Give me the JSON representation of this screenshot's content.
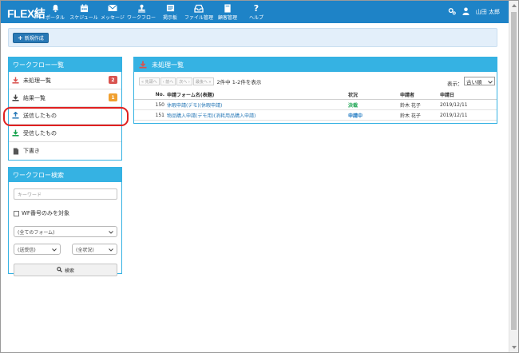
{
  "app": {
    "logo": "FLEX結",
    "nav": [
      {
        "label": "ポータル",
        "icon": "bell-icon"
      },
      {
        "label": "スケジュール",
        "icon": "calendar-icon"
      },
      {
        "label": "メッセージ",
        "icon": "envelope-icon"
      },
      {
        "label": "ワークフロー",
        "icon": "stamp-icon"
      },
      {
        "label": "掲示板",
        "icon": "board-icon"
      },
      {
        "label": "ファイル管理",
        "icon": "inbox-icon"
      },
      {
        "label": "顧客管理",
        "icon": "book-icon"
      },
      {
        "label": "ヘルプ",
        "icon": "question-icon"
      }
    ],
    "user_name": "山田 太郎"
  },
  "toolbar": {
    "new_label": "新規作成"
  },
  "workflow_list": {
    "title": "ワークフロー一覧",
    "items": [
      {
        "label": "未処理一覧",
        "icon": "download-red-icon",
        "badge": "2",
        "badge_color": "#d9534f"
      },
      {
        "label": "結果一覧",
        "icon": "download-dark-icon",
        "badge": "1",
        "badge_color": "#f0a030"
      },
      {
        "label": "送信したもの",
        "icon": "upload-blue-icon",
        "badge": ""
      },
      {
        "label": "受信したもの",
        "icon": "download-green-icon",
        "badge": ""
      },
      {
        "label": "下書き",
        "icon": "document-icon",
        "badge": ""
      }
    ]
  },
  "workflow_search": {
    "title": "ワークフロー検索",
    "keyword_placeholder": "キーワード",
    "wf_number_only_label": "WF番号のみを対象",
    "form_select": "(全てのフォーム)",
    "direction_select": "(送受信)",
    "status_select": "(全状況)",
    "search_button": "検索"
  },
  "main": {
    "title": "未処理一覧",
    "pager": {
      "first": "« 先頭へ",
      "prev": "‹ 前へ",
      "next": "次へ ›",
      "last": "最後へ »",
      "count_text": "2件中 1-2件を表示"
    },
    "display_label": "表示：",
    "display_value": "古い順",
    "columns": [
      "No.",
      "申請フォーム名(表題)",
      "状況",
      "申請者",
      "申請日"
    ],
    "rows": [
      {
        "no": "150",
        "form": "休暇申請(デモ)(休暇申請)",
        "status": "決裁",
        "applicant": "鈴木 花子",
        "date": "2019/12/11"
      },
      {
        "no": "151",
        "form": "物品購入申請(デモ用)(消耗用品購入申請)",
        "status": "申請中",
        "applicant": "鈴木 花子",
        "date": "2019/12/11"
      }
    ]
  }
}
